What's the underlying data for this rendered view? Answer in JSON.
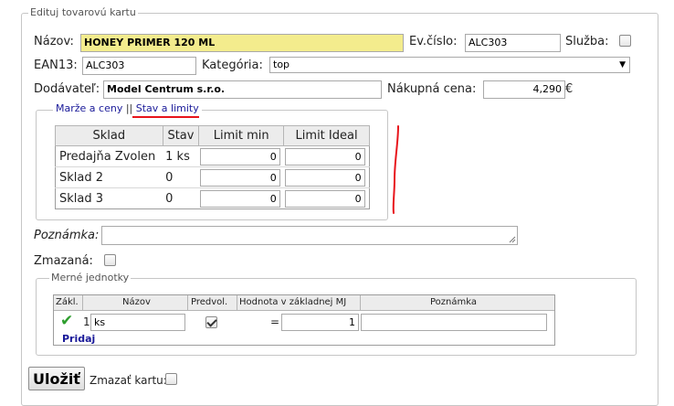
{
  "form": {
    "legend": "Edituj tovarovú kartu",
    "nazov_label": "Názov:",
    "nazov_value": "HONEY PRIMER 120 ML",
    "evcislo_label": "Ev.číslo:",
    "evcislo_value": "ALC303",
    "sluzba_label": "Služba:",
    "sluzba_checked": false,
    "ean_label": "EAN13:",
    "ean_value": "ALC303",
    "kategoria_label": "Kategória:",
    "kategoria_value": "top",
    "dodavatel_label": "Dodávateľ:",
    "dodavatel_value": "Model Centrum s.r.o.",
    "nakupna_label": "Nákupná cena:",
    "nakupna_value": "4,290",
    "currency": "€",
    "poznamka_label": "Poznámka:",
    "poznamka_value": "",
    "zmazana_label": "Zmazaná:",
    "zmazana_checked": false
  },
  "tabs": {
    "marze": "Marže a ceny",
    "separator": "||",
    "stav": "Stav a limity",
    "active_underline_color": "#e8141b"
  },
  "stock": {
    "headers": [
      "Sklad",
      "Stav",
      "Limit min",
      "Limit Ideal"
    ],
    "rows": [
      {
        "sklad": "Predajňa Zvolen",
        "stav": "1 ks",
        "limit_min": "0",
        "limit_ideal": "0"
      },
      {
        "sklad": "Sklad 2",
        "stav": "0",
        "limit_min": "0",
        "limit_ideal": "0"
      },
      {
        "sklad": "Sklad 3",
        "stav": "0",
        "limit_min": "0",
        "limit_ideal": "0"
      }
    ]
  },
  "units": {
    "legend": "Merné jednotky",
    "headers": [
      "Zákl.",
      "Názov",
      "Predvol.",
      "Hodnota v základnej MJ",
      "Poznámka"
    ],
    "row": {
      "num": "1",
      "nazov": "ks",
      "predvol_checked": true,
      "eq": "=",
      "hodnota": "1",
      "poznamka": ""
    },
    "add_link": "Pridaj",
    "check_color": "#2e9e2e"
  },
  "actions": {
    "save": "Uložiť",
    "delete_label": "Zmazať kartu:",
    "delete_checked": false
  },
  "colors": {
    "highlight": "#f3ec8d",
    "link": "#1a1a99",
    "annotation": "#e8141b"
  }
}
